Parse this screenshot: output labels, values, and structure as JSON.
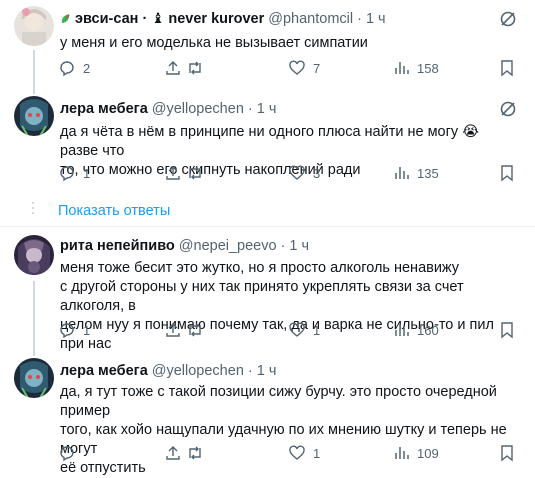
{
  "tweets": [
    {
      "name": "эвси-сан · ♝ never kurover",
      "handle": "@phantomcil",
      "time": "1 ч",
      "lines": [
        "у меня и его моделька не вызывает симпатии"
      ],
      "replies": "2",
      "retweets": "",
      "likes": "7",
      "views": "158"
    },
    {
      "name": "лера мебега",
      "handle": "@yellopechen",
      "time": "1 ч",
      "lines": [
        "да я чёта в нём в принципе ни одного плюса найти не могу 😭 разве что",
        "то, что можно его скипнуть накоплений ради"
      ],
      "replies": "1",
      "retweets": "",
      "likes": "3",
      "views": "135"
    },
    {
      "name": "рита непейпиво",
      "handle": "@nepei_peevo",
      "time": "1 ч",
      "lines": [
        "меня тоже бесит это жутко, но я просто алкоголь ненавижу",
        "с другой стороны у них так принято укреплять связи за счет алкоголя, в",
        "целом нуу я понимаю почему так, да и варка не сильно-то и пил при нас"
      ],
      "replies": "1",
      "retweets": "",
      "likes": "1",
      "views": "160"
    },
    {
      "name": "лера мебега",
      "handle": "@yellopechen",
      "time": "1 ч",
      "lines": [
        "да, я тут тоже с такой позиции сижу бурчу. это просто очередной пример",
        "того, как хойо нащупали удачную по их мнению шутку и теперь не могут",
        "её отпустить"
      ],
      "replies": "",
      "retweets": "",
      "likes": "1",
      "views": "109"
    }
  ],
  "show_replies": "Показать ответы",
  "colors": {
    "link": "#1d9bf0",
    "muted": "#536471",
    "text": "#0f1419"
  }
}
